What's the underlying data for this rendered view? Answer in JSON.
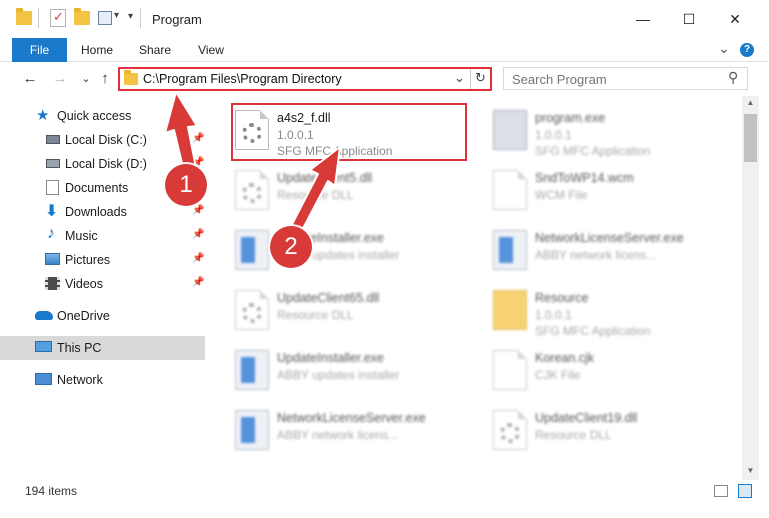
{
  "window": {
    "title": "Program",
    "minimize": "—",
    "maximize": "☐",
    "close": "✕"
  },
  "ribbon": {
    "tabs": [
      "File",
      "Home",
      "Share",
      "View"
    ],
    "expand_icon": "⌄",
    "help_icon": "?"
  },
  "address": {
    "path": "C:\\Program Files\\Program Directory",
    "dropdown": "⌄",
    "refresh": "↻"
  },
  "search": {
    "placeholder": "Search Program",
    "icon": "⚲"
  },
  "nav": {
    "back": "←",
    "forward": "→",
    "recent": "⌄",
    "up": "↑",
    "items": [
      {
        "label": "Quick access",
        "icon": "star-icon"
      },
      {
        "label": "Local Disk (C:)",
        "icon": "drive-icon",
        "pinned": true
      },
      {
        "label": "Local Disk (D:)",
        "icon": "drive-icon",
        "pinned": true
      },
      {
        "label": "Documents",
        "icon": "documents-icon",
        "pinned": true
      },
      {
        "label": "Downloads",
        "icon": "downloads-icon",
        "pinned": true
      },
      {
        "label": "Music",
        "icon": "music-icon",
        "pinned": true
      },
      {
        "label": "Pictures",
        "icon": "pictures-icon",
        "pinned": true
      },
      {
        "label": "Videos",
        "icon": "videos-icon",
        "pinned": true
      },
      {
        "label": "OneDrive",
        "icon": "cloud-icon"
      },
      {
        "label": "This PC",
        "icon": "computer-icon",
        "selected": true
      },
      {
        "label": "Network",
        "icon": "network-icon"
      }
    ],
    "pin_glyph": "📌"
  },
  "files": [
    {
      "name": "a4s2_f.dll",
      "line2": "1.0.0.1",
      "line3": "SFG MFC Application",
      "icon": "dll-gear-icon",
      "highlighted": true
    },
    {
      "name": "program.exe",
      "line2": "1.0.0.1",
      "line3": "SFG MFC Application",
      "icon": "exe-icon"
    },
    {
      "name": "UpdateClient5.dll",
      "line2": "Resource DLL",
      "line3": "",
      "icon": "dll-gear-icon"
    },
    {
      "name": "SndToWP14.wcm",
      "line2": "WCM File",
      "line3": "",
      "icon": "document-icon"
    },
    {
      "name": "UpdateInstaller.exe",
      "line2": "ABBY updates installer",
      "line3": "",
      "icon": "installer-icon"
    },
    {
      "name": "NetworkLicenseServer.exe",
      "line2": "ABBY network licens...",
      "line3": "",
      "icon": "installer-icon"
    },
    {
      "name": "UpdateClient65.dll",
      "line2": "Resource DLL",
      "line3": "",
      "icon": "dll-gear-icon"
    },
    {
      "name": "Resource",
      "line2": "1.0.0.1",
      "line3": "SFG MFC Application",
      "icon": "folder-icon"
    },
    {
      "name": "UpdateInstaller.exe",
      "line2": "ABBY updates installer",
      "line3": "",
      "icon": "installer-icon"
    },
    {
      "name": "Korean.cjk",
      "line2": "CJK File",
      "line3": "",
      "icon": "document-icon"
    },
    {
      "name": "NetworkLicenseServer.exe",
      "line2": "ABBY network licens...",
      "line3": "",
      "icon": "installer-icon"
    },
    {
      "name": "UpdateClient19.dll",
      "line2": "Resource DLL",
      "line3": "",
      "icon": "dll-gear-icon"
    }
  ],
  "status": {
    "count": "194 items"
  },
  "annotations": {
    "step1": "1",
    "step2": "2",
    "highlight_color": "#e0313b",
    "badge_color": "#d83a37"
  },
  "colors": {
    "accent": "#1979ca",
    "selection": "#d9d9d9"
  }
}
